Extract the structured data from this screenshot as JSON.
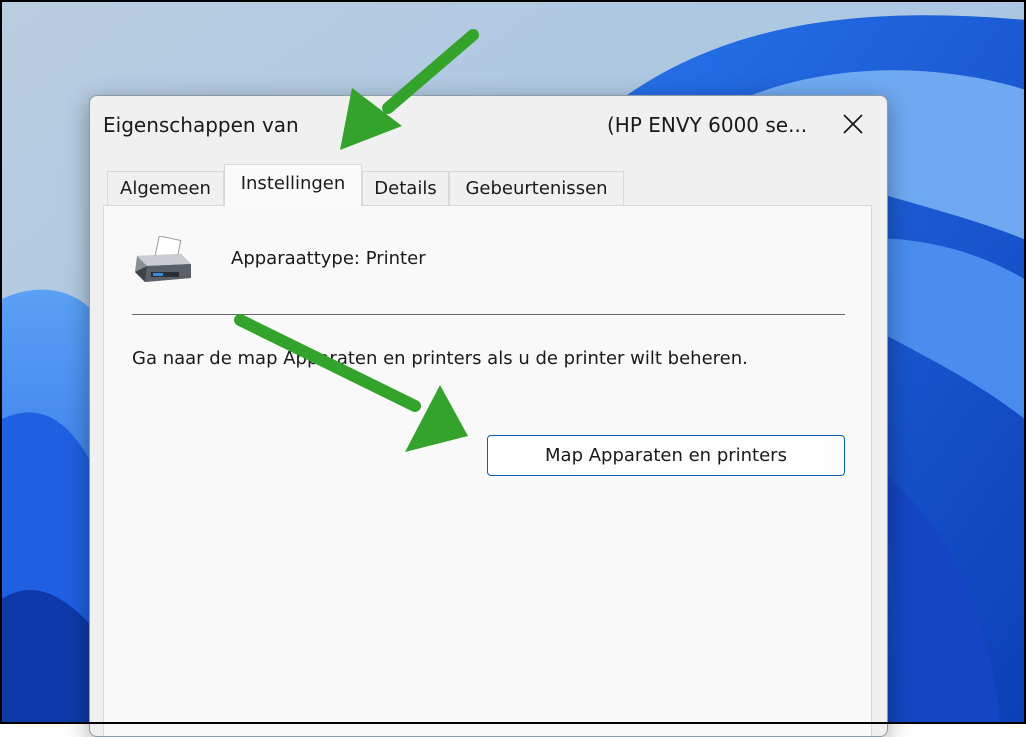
{
  "window": {
    "title_left": "Eigenschappen van",
    "title_right": "(HP ENVY 6000 se..."
  },
  "tabs": [
    {
      "label": "Algemeen",
      "active": false
    },
    {
      "label": "Instellingen",
      "active": true
    },
    {
      "label": "Details",
      "active": false
    },
    {
      "label": "Gebeurtenissen",
      "active": false
    }
  ],
  "panel": {
    "device_type": "Apparaattype: Printer",
    "info_text": "Ga naar de map Apparaten en printers als u de printer wilt beheren.",
    "open_button_label": "Map Apparaten en printers"
  },
  "icons": {
    "close": "close-icon",
    "device": "printer-icon",
    "annotations": "arrow-icon"
  },
  "colors": {
    "annotation_arrow": "#34a32c",
    "button_border": "#0a5fb4",
    "dialog_bg": "#f0f0f0",
    "wallpaper_blue": "#1b5ee0"
  }
}
